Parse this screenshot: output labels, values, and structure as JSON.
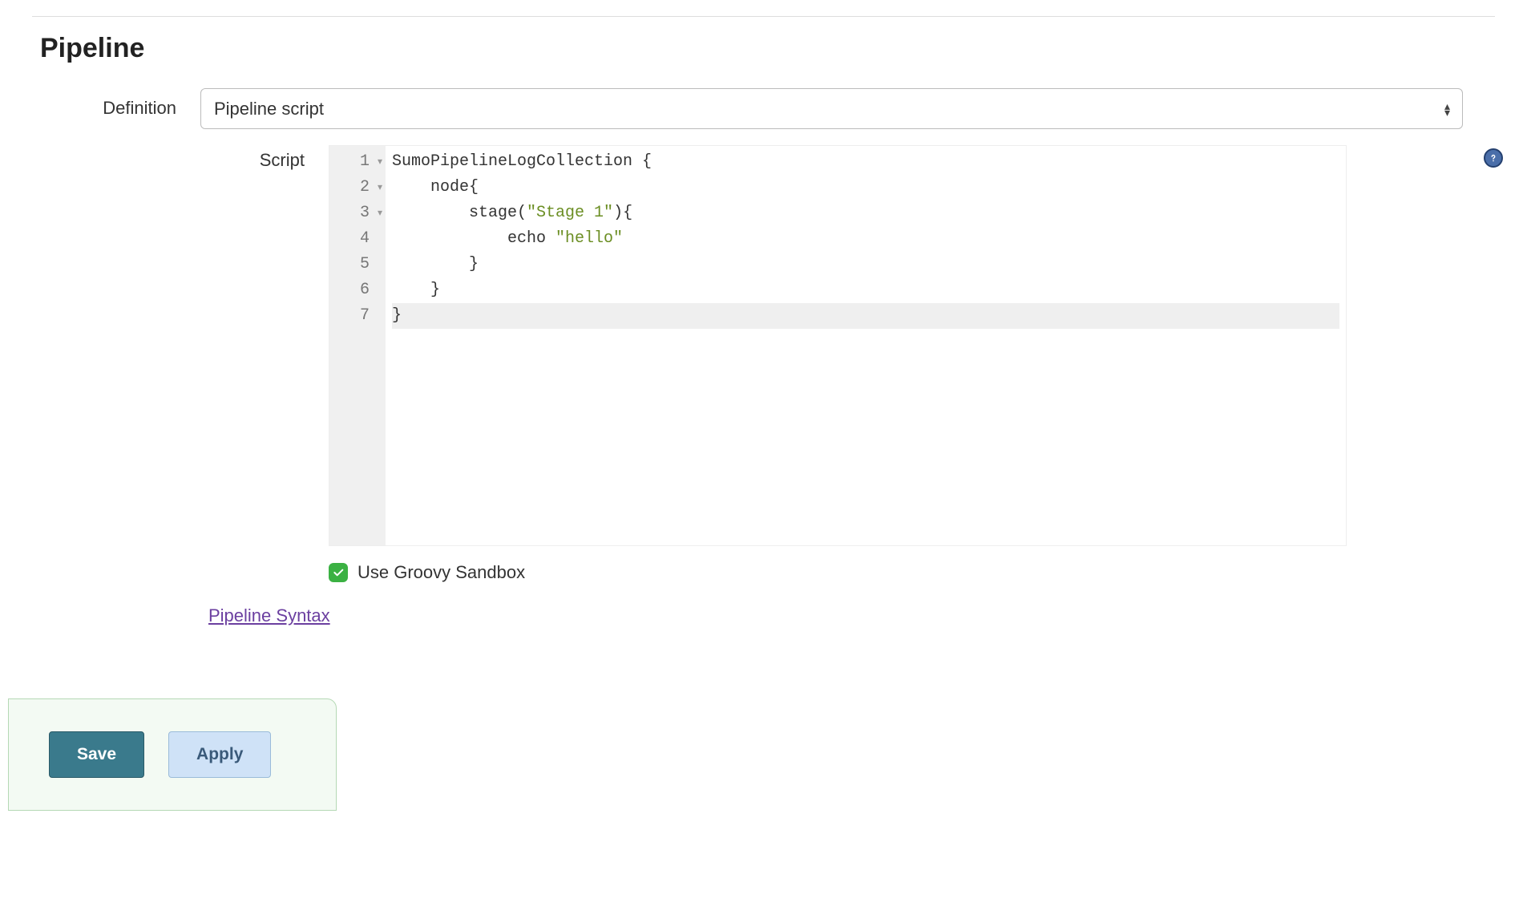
{
  "section": {
    "title": "Pipeline"
  },
  "definition": {
    "label": "Definition",
    "selected": "Pipeline script"
  },
  "script": {
    "label": "Script",
    "gutter": [
      "1",
      "2",
      "3",
      "4",
      "5",
      "6",
      "7"
    ],
    "fold_lines": [
      1,
      2,
      3
    ],
    "active_line": 7,
    "lines": [
      {
        "indent": 0,
        "segments": [
          {
            "t": "SumoPipelineLogCollection "
          },
          {
            "t": "{"
          }
        ]
      },
      {
        "indent": 1,
        "segments": [
          {
            "t": "node{"
          }
        ]
      },
      {
        "indent": 2,
        "segments": [
          {
            "t": "stage("
          },
          {
            "t": "\"Stage 1\"",
            "cls": "tok-str"
          },
          {
            "t": "){"
          }
        ]
      },
      {
        "indent": 3,
        "segments": [
          {
            "t": "echo "
          },
          {
            "t": "\"hello\"",
            "cls": "tok-str"
          }
        ]
      },
      {
        "indent": 2,
        "segments": [
          {
            "t": "}"
          }
        ]
      },
      {
        "indent": 1,
        "segments": [
          {
            "t": "}"
          }
        ]
      },
      {
        "indent": 0,
        "segments": [
          {
            "t": "}"
          }
        ]
      }
    ]
  },
  "sandbox": {
    "label": "Use Groovy Sandbox",
    "checked": true
  },
  "links": {
    "pipeline_syntax": "Pipeline Syntax"
  },
  "buttons": {
    "save": "Save",
    "apply": "Apply"
  }
}
